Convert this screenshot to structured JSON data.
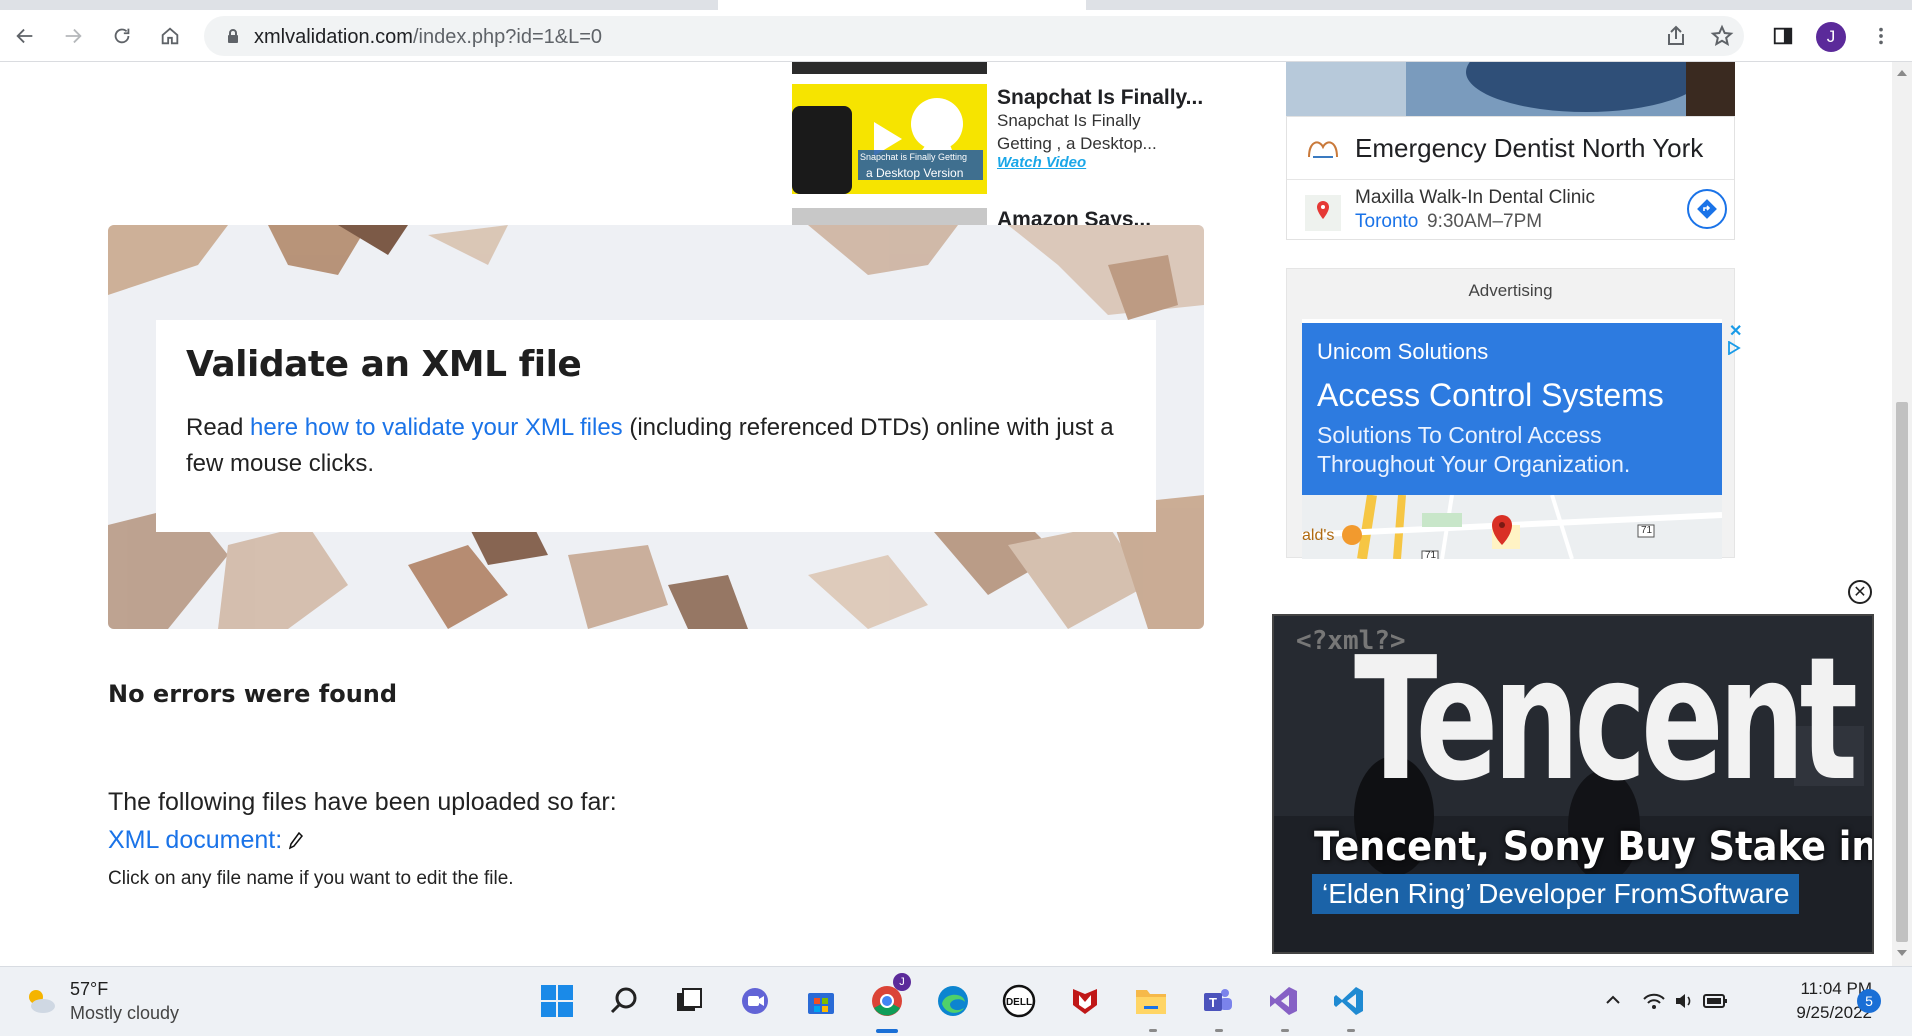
{
  "browser": {
    "url_host": "xmlvalidation.com",
    "url_path": "/index.php?id=1&L=0",
    "profile_initial": "J"
  },
  "related_videos": [
    {
      "title": "Snapchat Is Finally...",
      "subtitle": "Snapchat Is Finally Getting , a Desktop...",
      "link": "Watch Video",
      "thumb_caption_1": "Snapchat is Finally Getting",
      "thumb_caption_2": "a Desktop Version"
    },
    {
      "title": "Amazon Says..."
    }
  ],
  "hero": {
    "title": "Validate an XML file",
    "text_before": "Read ",
    "link": "here how to validate your XML files",
    "text_after": " (including referenced DTDs) online with just a few mouse clicks."
  },
  "result": {
    "status": "No errors were found",
    "files_intro": "The following files have been uploaded so far:",
    "file_link": "XML document:",
    "edit_hint": "Click on any file name if you want to edit the file."
  },
  "local_ad": {
    "title": "Emergency Dentist North York",
    "clinic_name": "Maxilla Walk-In Dental Clinic",
    "clinic_city": "Toronto",
    "clinic_hours": "9:30AM–7PM"
  },
  "advert": {
    "label": "Advertising",
    "brand": "Unicom Solutions",
    "headline": "Access Control Systems",
    "description": "Solutions To Control Access Throughout Your Organization.",
    "map_label": "ald's",
    "map_route_1": "71",
    "map_route_2": "71"
  },
  "floating_video": {
    "overlay_code": "<?xml?>",
    "sign_word": "Tencent",
    "headline_1": "Tencent, Sony Buy Stake in",
    "headline_2": "‘Elden Ring’ Developer FromSoftware"
  },
  "taskbar": {
    "temperature": "57°F",
    "weather": "Mostly cloudy",
    "time": "11:04 PM",
    "date": "9/25/2022",
    "notifications": "5",
    "chrome_badge": "J"
  },
  "colors": {
    "link": "#1a73e8",
    "ad_blue": "#2d7be0",
    "caption_blue": "#1b63a8"
  }
}
